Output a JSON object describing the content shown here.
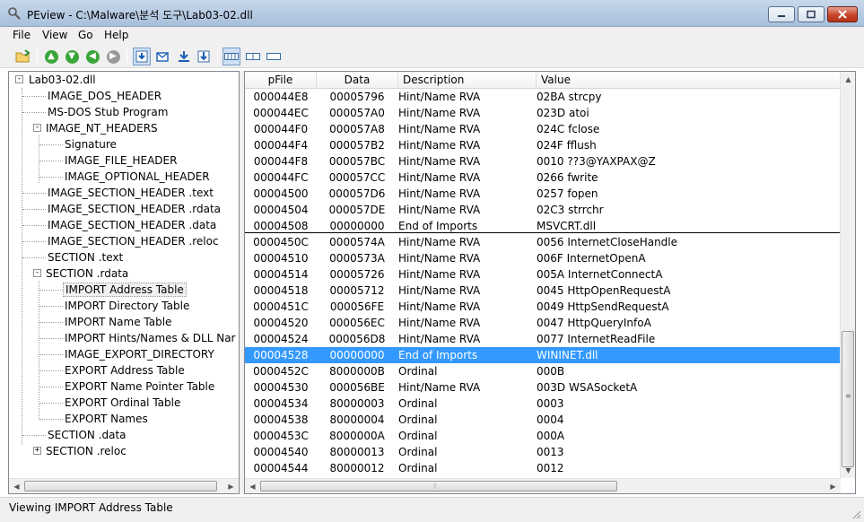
{
  "window": {
    "title": "PEview - C:\\Malware\\분석 도구\\Lab03-02.dll",
    "controls": {
      "minimize": "minimize",
      "maximize": "maximize",
      "close": "close"
    }
  },
  "menu": [
    "File",
    "View",
    "Go",
    "Help"
  ],
  "toolbar": {
    "icons": [
      "open-folder-icon",
      "go-up-icon",
      "go-down-icon",
      "go-back-icon",
      "go-forward-icon",
      "view-down-icon",
      "view-mail-icon",
      "view-import-icon",
      "view-export-icon",
      "view-byte-icon",
      "view-word-icon",
      "view-dword-icon"
    ]
  },
  "tree": {
    "root": "Lab03-02.dll",
    "items": [
      "IMAGE_DOS_HEADER",
      "MS-DOS Stub Program",
      "IMAGE_NT_HEADERS",
      "Signature",
      "IMAGE_FILE_HEADER",
      "IMAGE_OPTIONAL_HEADER",
      "IMAGE_SECTION_HEADER .text",
      "IMAGE_SECTION_HEADER .rdata",
      "IMAGE_SECTION_HEADER .data",
      "IMAGE_SECTION_HEADER .reloc",
      "SECTION .text",
      "SECTION .rdata",
      "IMPORT Address Table",
      "IMPORT Directory Table",
      "IMPORT Name Table",
      "IMPORT Hints/Names & DLL Nar",
      "IMAGE_EXPORT_DIRECTORY",
      "EXPORT Address Table",
      "EXPORT Name Pointer Table",
      "EXPORT Ordinal Table",
      "EXPORT Names",
      "SECTION .data",
      "SECTION .reloc"
    ],
    "expander_minus": "-",
    "expander_plus": "+",
    "selected": "IMPORT Address Table"
  },
  "list": {
    "columns": [
      "pFile",
      "Data",
      "Description",
      "Value"
    ],
    "rows": [
      [
        "000044E8",
        "00005796",
        "Hint/Name RVA",
        "02BA  strcpy"
      ],
      [
        "000044EC",
        "000057A0",
        "Hint/Name RVA",
        "023D  atoi"
      ],
      [
        "000044F0",
        "000057A8",
        "Hint/Name RVA",
        "024C  fclose"
      ],
      [
        "000044F4",
        "000057B2",
        "Hint/Name RVA",
        "024F  fflush"
      ],
      [
        "000044F8",
        "000057BC",
        "Hint/Name RVA",
        "0010  ??3@YAXPAX@Z"
      ],
      [
        "000044FC",
        "000057CC",
        "Hint/Name RVA",
        "0266  fwrite"
      ],
      [
        "00004500",
        "000057D6",
        "Hint/Name RVA",
        "0257  fopen"
      ],
      [
        "00004504",
        "000057DE",
        "Hint/Name RVA",
        "02C3  strrchr"
      ],
      [
        "00004508",
        "00000000",
        "End of Imports",
        "MSVCRT.dll"
      ],
      [
        "0000450C",
        "0000574A",
        "Hint/Name RVA",
        "0056  InternetCloseHandle"
      ],
      [
        "00004510",
        "0000573A",
        "Hint/Name RVA",
        "006F  InternetOpenA"
      ],
      [
        "00004514",
        "00005726",
        "Hint/Name RVA",
        "005A  InternetConnectA"
      ],
      [
        "00004518",
        "00005712",
        "Hint/Name RVA",
        "0045  HttpOpenRequestA"
      ],
      [
        "0000451C",
        "000056FE",
        "Hint/Name RVA",
        "0049  HttpSendRequestA"
      ],
      [
        "00004520",
        "000056EC",
        "Hint/Name RVA",
        "0047  HttpQueryInfoA"
      ],
      [
        "00004524",
        "000056D8",
        "Hint/Name RVA",
        "0077  InternetReadFile"
      ],
      [
        "00004528",
        "00000000",
        "End of Imports",
        "WININET.dll"
      ],
      [
        "0000452C",
        "8000000B",
        "Ordinal",
        "000B"
      ],
      [
        "00004530",
        "000056BE",
        "Hint/Name RVA",
        "003D  WSASocketA"
      ],
      [
        "00004534",
        "80000003",
        "Ordinal",
        "0003"
      ],
      [
        "00004538",
        "80000004",
        "Ordinal",
        "0004"
      ],
      [
        "0000453C",
        "8000000A",
        "Ordinal",
        "000A"
      ],
      [
        "00004540",
        "80000013",
        "Ordinal",
        "0013"
      ],
      [
        "00004544",
        "80000012",
        "Ordinal",
        "0012"
      ]
    ],
    "selected_row": "00004528"
  },
  "status": "Viewing IMPORT Address Table",
  "colors": {
    "selection": "#3399ff",
    "panel": "#f0f0f0",
    "close_button": "#c7442b"
  }
}
